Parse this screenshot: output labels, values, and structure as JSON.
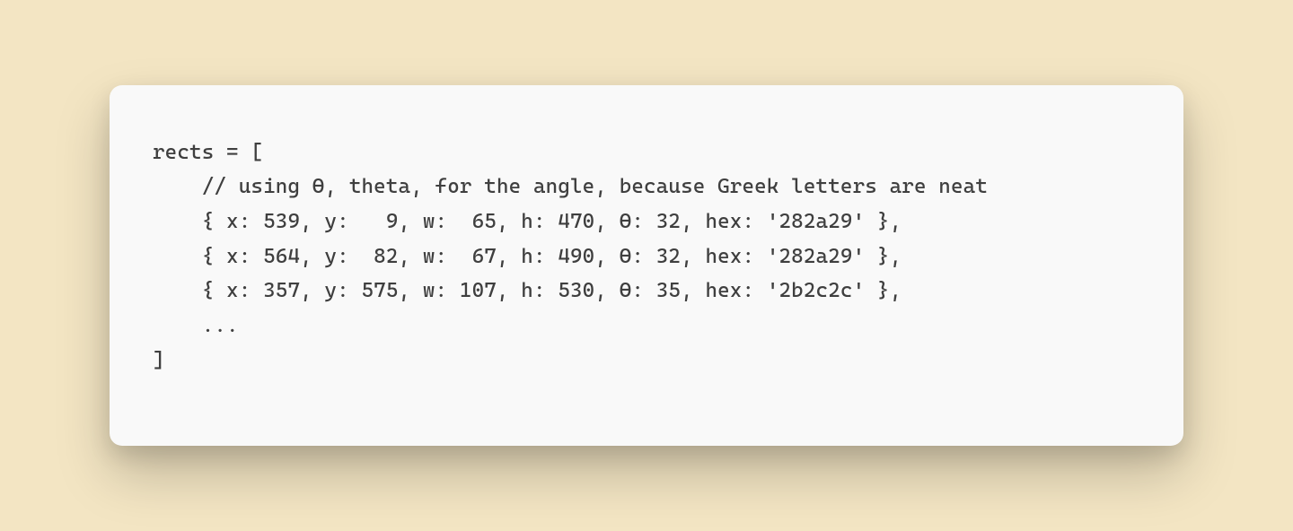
{
  "code": {
    "line1": "rects = [",
    "line2": "    // using Θ, theta, for the angle, because Greek letters are neat",
    "line3": "    { x: 539, y:   9, w:  65, h: 470, Θ: 32, hex: '282a29' },",
    "line4": "    { x: 564, y:  82, w:  67, h: 490, Θ: 32, hex: '282a29' },",
    "line5": "    { x: 357, y: 575, w: 107, h: 530, Θ: 35, hex: '2b2c2c' },",
    "line6": "    ...",
    "line7": "]"
  }
}
